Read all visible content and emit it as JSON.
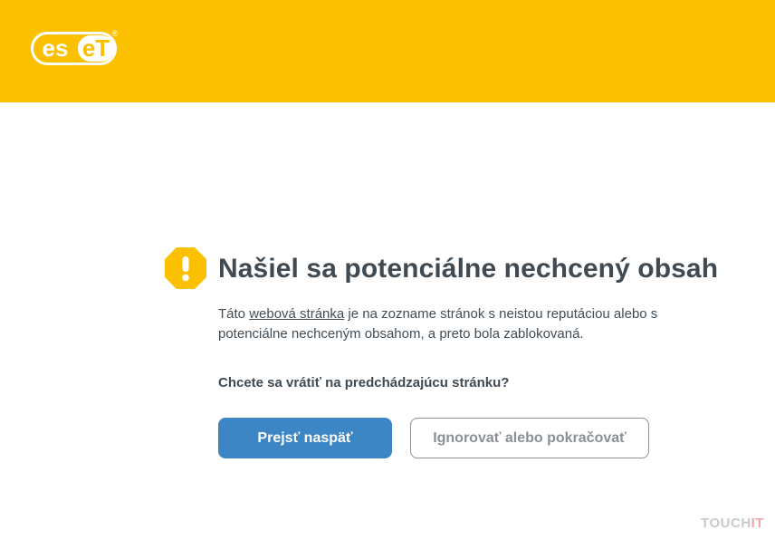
{
  "brand": {
    "name": "ESET",
    "logo_text_es": "es",
    "logo_text_et": "eT",
    "registered_mark": "®"
  },
  "colors": {
    "header_bg": "#fbc100",
    "warning_icon": "#fbc100",
    "primary_button": "#3d86c6",
    "text": "#424d56"
  },
  "warning": {
    "icon": "warning-octagon-icon",
    "title": "Našiel sa potenciálne nechcený obsah",
    "desc_before_link": "Táto ",
    "desc_link": "webová stránka",
    "desc_after_link": " je na zozname stránok s neistou reputáciou alebo s potenciálne nechceným obsahom, a preto bola zablokovaná."
  },
  "question": "Chcete sa vrátiť na predchádzajúcu stránku?",
  "buttons": {
    "back": "Prejsť naspäť",
    "ignore": "Ignorovať alebo pokračovať"
  },
  "watermark": {
    "part1": "TOUCH",
    "part2": "IT"
  }
}
